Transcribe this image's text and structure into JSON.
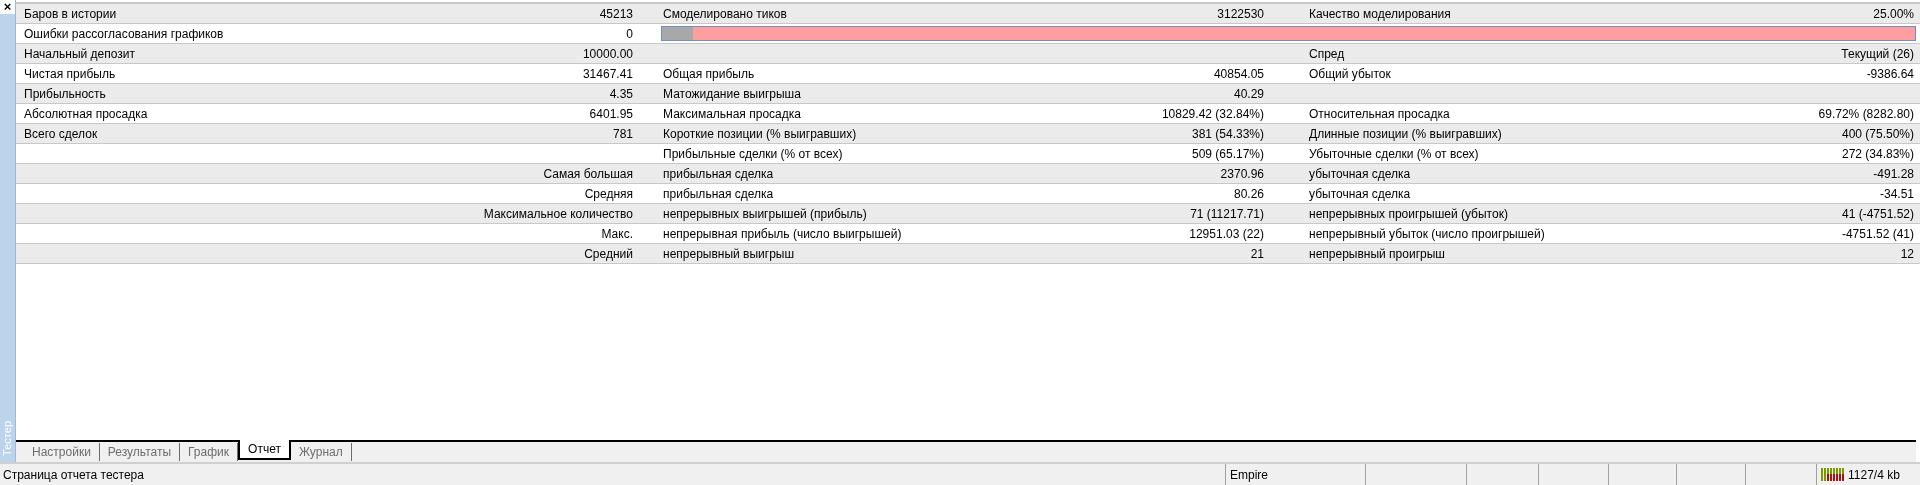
{
  "panel": {
    "close": "×",
    "title": "Тестер"
  },
  "rows": [
    {
      "kind": "stats",
      "left": {
        "label": "Баров в истории",
        "value": "45213"
      },
      "middle": {
        "label": "Смоделировано тиков",
        "value": "3122530"
      },
      "right": {
        "label": "Качество моделирования",
        "value": "25.00%"
      }
    },
    {
      "kind": "quality_bar",
      "left": {
        "label": "Ошибки рассогласования графиков",
        "value": "0"
      },
      "level": 0.025
    },
    {
      "kind": "stats",
      "left": {
        "label": "Начальный депозит",
        "value": "10000.00"
      },
      "right": {
        "label": "Спред",
        "value": "Текущий (26)"
      }
    },
    {
      "kind": "stats",
      "left": {
        "label": "Чистая прибыль",
        "value": "31467.41"
      },
      "middle": {
        "label": "Общая прибыль",
        "value": "40854.05"
      },
      "right": {
        "label": "Общий убыток",
        "value": "-9386.64"
      }
    },
    {
      "kind": "stats",
      "left": {
        "label": "Прибыльность",
        "value": "4.35"
      },
      "middle": {
        "label": "Матожидание выигрыша",
        "value": "40.29"
      }
    },
    {
      "kind": "stats",
      "left": {
        "label": "Абсолютная просадка",
        "value": "6401.95"
      },
      "middle": {
        "label": "Максимальная просадка",
        "value": "10829.42 (32.84%)"
      },
      "right": {
        "label": "Относительная просадка",
        "value": "69.72% (8282.80)"
      }
    },
    {
      "kind": "stats",
      "left": {
        "label": "Всего сделок",
        "value": "781"
      },
      "middle": {
        "label": "Короткие позиции (% выигравших)",
        "value": "381 (54.33%)"
      },
      "right": {
        "label": "Длинные позиции (% выигравших)",
        "value": "400 (75.50%)"
      }
    },
    {
      "kind": "stats",
      "middle": {
        "label": "Прибыльные сделки (% от всех)",
        "value": "509 (65.17%)"
      },
      "right": {
        "label": "Убыточные сделки (% от всех)",
        "value": "272 (34.83%)"
      }
    },
    {
      "kind": "stats",
      "left": {
        "value": "Самая большая"
      },
      "middle": {
        "label": "прибыльная сделка",
        "value": "2370.96"
      },
      "right": {
        "label": "убыточная сделка",
        "value": "-491.28"
      }
    },
    {
      "kind": "stats",
      "left": {
        "value": "Средняя"
      },
      "middle": {
        "label": "прибыльная сделка",
        "value": "80.26"
      },
      "right": {
        "label": "убыточная сделка",
        "value": "-34.51"
      }
    },
    {
      "kind": "stats",
      "left": {
        "value": "Максимальное количество"
      },
      "middle": {
        "label": "непрерывных выигрышей (прибыль)",
        "value": "71 (11217.71)"
      },
      "right": {
        "label": "непрерывных проигрышей (убыток)",
        "value": "41 (-4751.52)"
      }
    },
    {
      "kind": "stats",
      "left": {
        "value": "Макс."
      },
      "middle": {
        "label": "непрерывная прибыль (число выигрышей)",
        "value": "12951.03 (22)"
      },
      "right": {
        "label": "непрерывный убыток (число проигрышей)",
        "value": "-4751.52 (41)"
      }
    },
    {
      "kind": "stats",
      "left": {
        "value": "Средний"
      },
      "middle": {
        "label": "непрерывный выигрыш",
        "value": "21"
      },
      "right": {
        "label": "непрерывный проигрыш",
        "value": "12"
      }
    }
  ],
  "tabs": [
    {
      "label": "Настройки",
      "selected": false
    },
    {
      "label": "Результаты",
      "selected": false
    },
    {
      "label": "График",
      "selected": false
    },
    {
      "label": "Отчет",
      "selected": true
    },
    {
      "label": "Журнал",
      "selected": false
    }
  ],
  "status_bar": {
    "message": "Страница отчета тестера",
    "profile": "Empire",
    "traffic": "1127/4 kb"
  }
}
